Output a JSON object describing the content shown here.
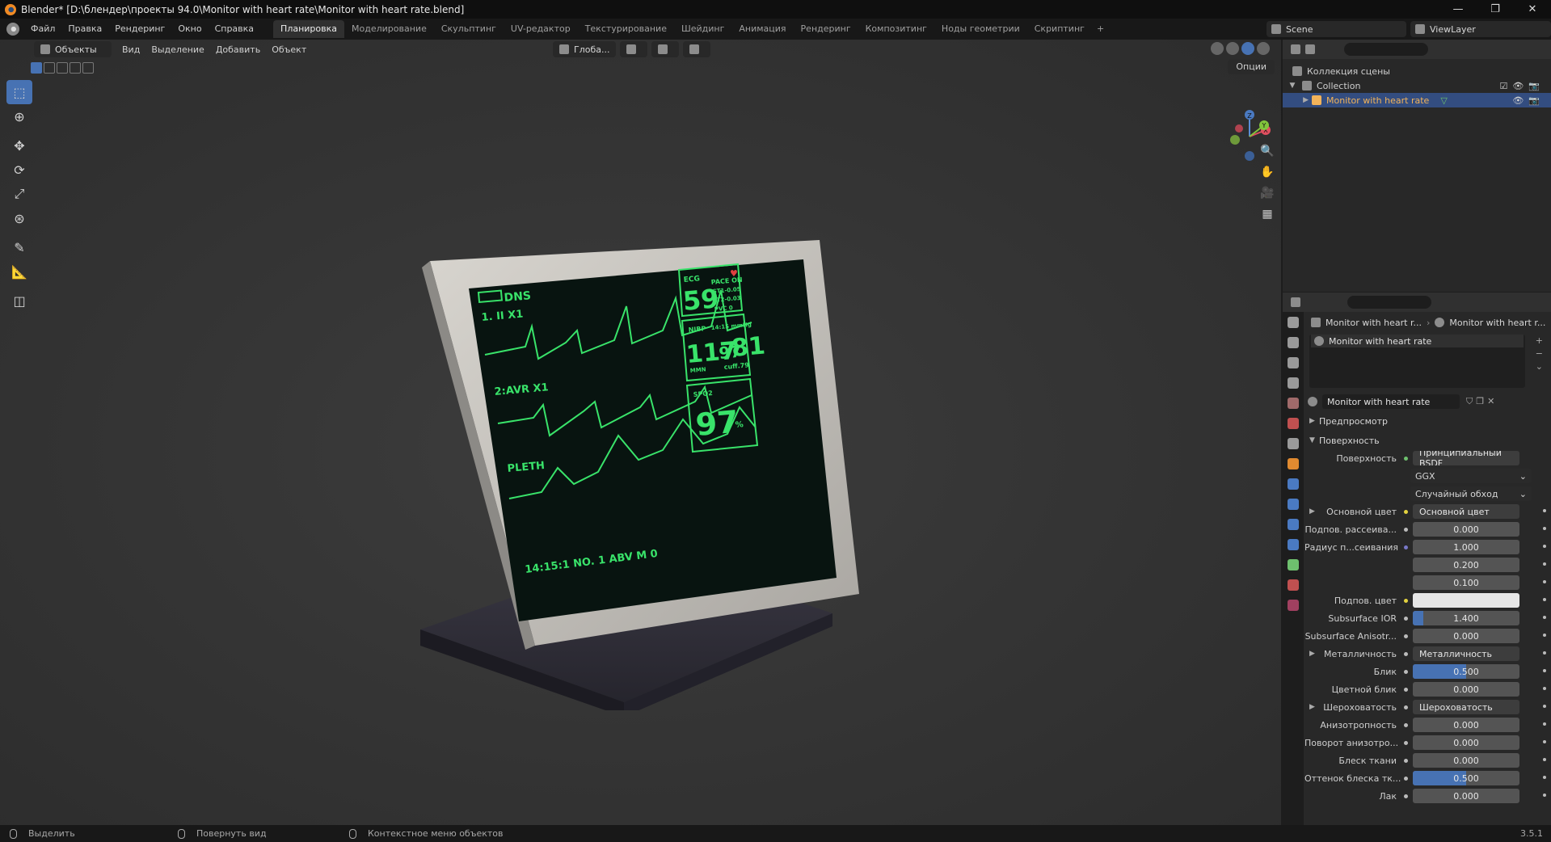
{
  "window": {
    "title": "Blender* [D:\\блендер\\проекты 94.0\\Monitor with heart rate\\Monitor with heart rate.blend]",
    "min": "—",
    "max": "❐",
    "close": "✕"
  },
  "menu": [
    "Файл",
    "Правка",
    "Рендеринг",
    "Окно",
    "Справка"
  ],
  "workspaces": [
    "Планировка",
    "Моделирование",
    "Скульптинг",
    "UV-редактор",
    "Текстурирование",
    "Шейдинг",
    "Анимация",
    "Рендеринг",
    "Композитинг",
    "Ноды геометрии",
    "Скриптинг"
  ],
  "active_workspace": "Планировка",
  "add_workspace": "+",
  "scene": "Scene",
  "view_layer": "ViewLayer",
  "viewport": {
    "mode": "Объекты",
    "menu": [
      "Вид",
      "Выделение",
      "Добавить",
      "Объект"
    ],
    "transform_orientation": "Глоба...",
    "options": "Опции"
  },
  "monitor_screen": {
    "battery_label": "DNS",
    "lead1": "1.   II   X1",
    "lead2": "2:AVR  X1",
    "pleth": "PLETH",
    "footer": "14:15:1   NO. 1   ABV  M 0",
    "ecg": "ECG",
    "pace": "PACE ON",
    "st1": "ST1-0.05",
    "st2": "ST2-0.03",
    "pvc": "PVC 0",
    "hr": "59",
    "nibp": "NIBP",
    "nibp_time": "14:15 mmHg",
    "sys": "117",
    "dia": "97",
    "map": "81",
    "mmn": "MMN",
    "cuff": "cuff.79",
    "spo2_label": "SPO2",
    "spo2": "97",
    "pct": "%"
  },
  "outliner": {
    "scene_collection": "Коллекция сцены",
    "collection": "Collection",
    "object": "Monitor with heart rate"
  },
  "properties": {
    "breadcrumb_object": "Monitor with heart r...",
    "breadcrumb_material": "Monitor with heart r...",
    "slot": "Monitor with heart rate",
    "material": "Monitor with heart rate",
    "preview": "Предпросмотр",
    "surface_panel": "Поверхность",
    "surface_label": "Поверхность",
    "surface_value": "Принципиальный BSDF",
    "distribution": "GGX",
    "subsurface_method": "Случайный обход",
    "rows": [
      {
        "label": "Основной цвет",
        "value": "Основной цвет",
        "kind": "link",
        "dot": "yellow"
      },
      {
        "label": "Подпов. рассеива...",
        "value": "0.000",
        "kind": "num",
        "dot": "gray"
      },
      {
        "label": "Радиус п...сеивания",
        "value": "1.000",
        "kind": "num",
        "dot": "purple"
      },
      {
        "label": "",
        "value": "0.200",
        "kind": "num",
        "dot": ""
      },
      {
        "label": "",
        "value": "0.100",
        "kind": "num",
        "dot": ""
      },
      {
        "label": "Подпов. цвет",
        "value": "",
        "kind": "color",
        "dot": "yellow"
      },
      {
        "label": "Subsurface IOR",
        "value": "1.400",
        "kind": "num",
        "dot": "gray",
        "fill": 0.1
      },
      {
        "label": "Subsurface Anisotr...",
        "value": "0.000",
        "kind": "num",
        "dot": "gray"
      },
      {
        "label": "Металличность",
        "value": "Металличность",
        "kind": "link",
        "dot": "gray"
      },
      {
        "label": "Блик",
        "value": "0.500",
        "kind": "num",
        "dot": "gray",
        "fill": 0.5
      },
      {
        "label": "Цветной блик",
        "value": "0.000",
        "kind": "num",
        "dot": "gray"
      },
      {
        "label": "Шероховатость",
        "value": "Шероховатость",
        "kind": "link",
        "dot": "gray"
      },
      {
        "label": "Анизотропность",
        "value": "0.000",
        "kind": "num",
        "dot": "gray"
      },
      {
        "label": "Поворот анизотро...",
        "value": "0.000",
        "kind": "num",
        "dot": "gray"
      },
      {
        "label": "Блеск ткани",
        "value": "0.000",
        "kind": "num",
        "dot": "gray"
      },
      {
        "label": "Оттенок блеска тк...",
        "value": "0.500",
        "kind": "num",
        "dot": "gray",
        "fill": 0.5
      },
      {
        "label": "Лак",
        "value": "0.000",
        "kind": "num",
        "dot": "gray"
      }
    ]
  },
  "statusbar": {
    "select": "Выделить",
    "rotate": "Повернуть вид",
    "context": "Контекстное меню объектов",
    "version": "3.5.1"
  },
  "colors": {
    "accent": "#4772b3",
    "selection": "#334d80",
    "object_highlight": "#f2b35a",
    "screen_green": "#39e36a"
  }
}
